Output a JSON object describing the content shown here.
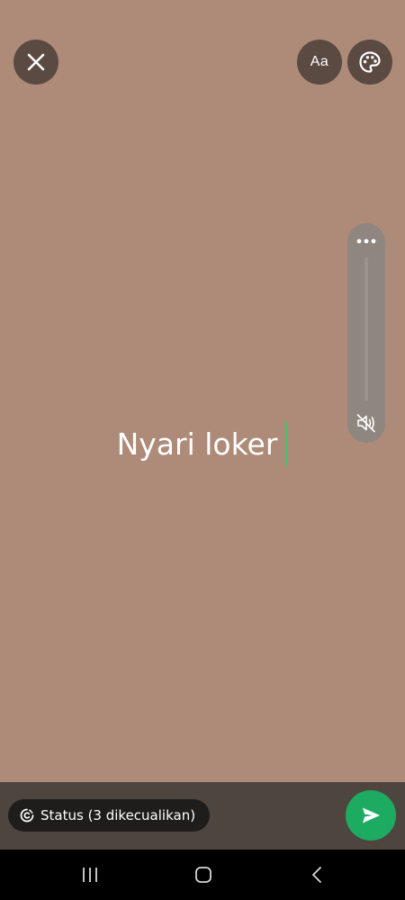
{
  "toolbar": {
    "close_icon": "close-icon",
    "font_label": "Aa",
    "palette_icon": "palette-icon"
  },
  "side_panel": {
    "more_icon": "more-horizontal-icon",
    "mute_icon": "volume-off-icon"
  },
  "status": {
    "text": "Nyari loker"
  },
  "bottom": {
    "audience_label": "Status (3 dikecualikan)",
    "audience_icon": "status-privacy-icon",
    "send_icon": "send-icon"
  },
  "colors": {
    "background": "#ad8b78",
    "accent": "#1daa61",
    "caret": "#25d366"
  }
}
